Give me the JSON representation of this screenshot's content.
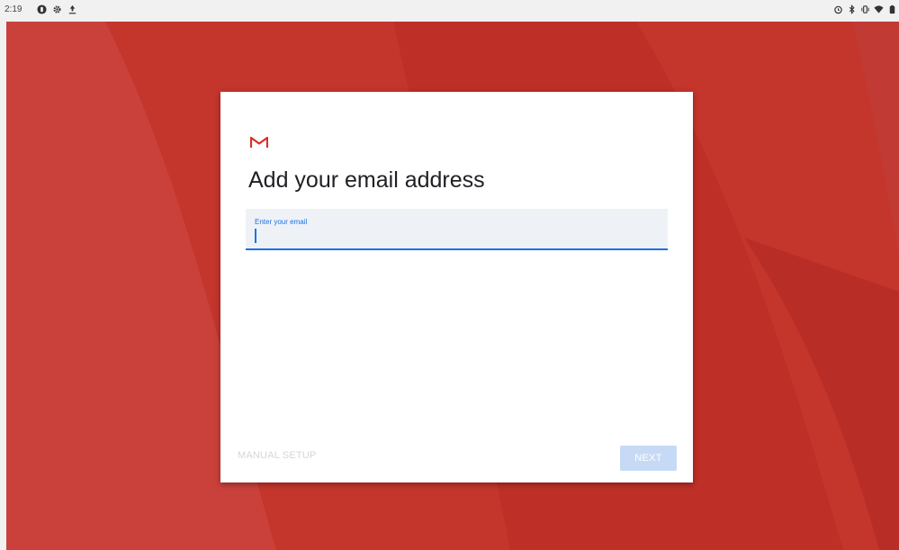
{
  "status_bar": {
    "time": "2:19",
    "left_icons": [
      "notification-icon",
      "settings-icon",
      "upload-icon"
    ],
    "right_icons": [
      "alarm-icon",
      "bluetooth-icon",
      "vibrate-icon",
      "wifi-icon",
      "battery-icon"
    ]
  },
  "colors": {
    "background": "#c4352c",
    "accent": "#1a73e8",
    "next_button": "#c6daf6",
    "gmail_red": "#d93025"
  },
  "card": {
    "logo": "gmail-logo",
    "title": "Add your email address",
    "email_field": {
      "label": "Enter your email",
      "value": ""
    },
    "manual_setup_label": "MANUAL SETUP",
    "next_label": "NEXT"
  }
}
